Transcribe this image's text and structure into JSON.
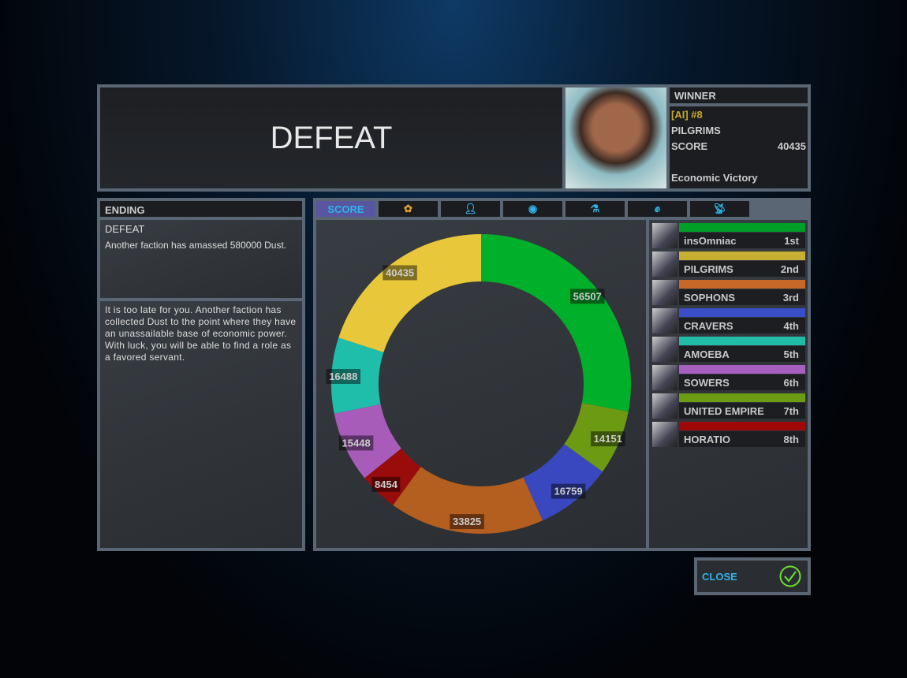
{
  "header": {
    "title": "DEFEAT"
  },
  "winner": {
    "heading": "WINNER",
    "player": "[AI] #8",
    "faction": "PILGRIMS",
    "score_label": "SCORE",
    "score": "40435",
    "victory": "Economic Victory"
  },
  "ending": {
    "heading": "ENDING",
    "title": "DEFEAT",
    "summary": "Another faction has amassed 580000 Dust.",
    "description": "It is too late for you. Another faction has collected Dust to the point where they have an unassailable base of economic power. With luck, you will be able to find a role as a favored servant."
  },
  "tabs": [
    {
      "label": "SCORE",
      "active": true
    },
    {
      "icon": "empire-icons"
    },
    {
      "icon": "population-icon"
    },
    {
      "icon": "planet-icon"
    },
    {
      "icon": "science-icon"
    },
    {
      "icon": "industry-fist-icon"
    },
    {
      "icon": "satellite-dish-icon"
    }
  ],
  "chart_data": {
    "type": "pie",
    "donut": true,
    "categories": [
      "insOmniac",
      "UNITED EMPIRE",
      "CRAVERS",
      "SOPHONS",
      "HORATIO",
      "SOWERS",
      "AMOEBA",
      "PILGRIMS"
    ],
    "values": [
      56507,
      14151,
      16759,
      33825,
      8454,
      15448,
      16488,
      40435
    ],
    "colors": [
      "#00b02a",
      "#6c9a12",
      "#3a48c0",
      "#b45e20",
      "#9a0c0c",
      "#a85cba",
      "#1ebeaa",
      "#e8c83a"
    ]
  },
  "rankings": [
    {
      "name": "insOmniac",
      "place": "1st",
      "color": "#00a028"
    },
    {
      "name": "PILGRIMS",
      "place": "2nd",
      "color": "#c8b035"
    },
    {
      "name": "SOPHONS",
      "place": "3rd",
      "color": "#c86828"
    },
    {
      "name": "CRAVERS",
      "place": "4th",
      "color": "#3a4ec8"
    },
    {
      "name": "AMOEBA",
      "place": "5th",
      "color": "#20bca8"
    },
    {
      "name": "SOWERS",
      "place": "6th",
      "color": "#a860c0"
    },
    {
      "name": "UNITED EMPIRE",
      "place": "7th",
      "color": "#6c9c14"
    },
    {
      "name": "HORATIO",
      "place": "8th",
      "color": "#a00808"
    }
  ],
  "close": {
    "label": "CLOSE"
  }
}
